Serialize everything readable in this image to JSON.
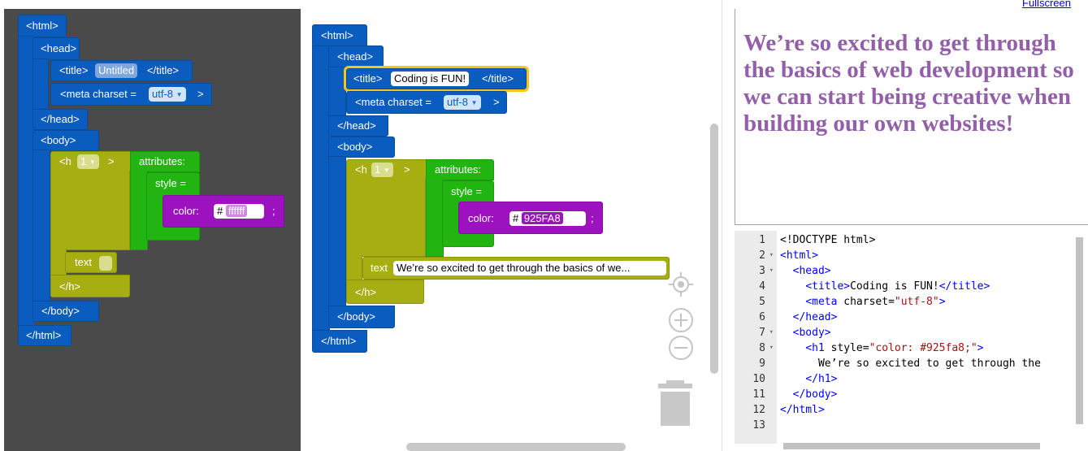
{
  "toolbox": {
    "html_open": "<html>",
    "head_open": "<head>",
    "title_open": "<title>",
    "title_value": "Untitled",
    "title_close": "</title>",
    "meta_label": "<meta charset =",
    "meta_value": "utf-8",
    "meta_close": ">",
    "head_close": "</head>",
    "body_open": "<body>",
    "h_label": "<h",
    "h_level": "1",
    "h_gt": ">",
    "attributes_label": "attributes:",
    "style_label": "style =",
    "color_label": "color:",
    "hash": "#",
    "color_value": "ffffff",
    "semicolon": ";",
    "text_label": "text",
    "text_value": "",
    "h_close": "</h>",
    "body_close": "</body>",
    "html_close": "</html>"
  },
  "workspace": {
    "html_open": "<html>",
    "head_open": "<head>",
    "title_open": "<title>",
    "title_value": "Coding is FUN!",
    "title_close": "</title>",
    "meta_label": "<meta charset =",
    "meta_value": "utf-8",
    "meta_close": ">",
    "head_close": "</head>",
    "body_open": "<body>",
    "h_label": "<h",
    "h_level": "1",
    "h_gt": ">",
    "attributes_label": "attributes:",
    "style_label": "style =",
    "color_label": "color:",
    "hash": "#",
    "color_value": "925FA8",
    "semicolon": ";",
    "text_label": "text",
    "text_value": "We’re so excited to get through the basics of we...",
    "h_close": "</h>",
    "body_close": "</body>",
    "html_close": "</html>"
  },
  "controls": {
    "center_icon": "crosshair-icon",
    "zoom_in_icon": "plus-circle-icon",
    "zoom_out_icon": "minus-circle-icon",
    "trash_icon": "trash-icon"
  },
  "preview": {
    "fullscreen_label": "Fullscreen",
    "heading": "We’re so excited to get through the basics of web development so we can start being creative when building our own websites!",
    "heading_color": "#925fa8"
  },
  "editor": {
    "lines": [
      {
        "num": "1",
        "fold": ""
      },
      {
        "num": "2",
        "fold": "▾"
      },
      {
        "num": "3",
        "fold": "▾"
      },
      {
        "num": "4",
        "fold": ""
      },
      {
        "num": "5",
        "fold": ""
      },
      {
        "num": "6",
        "fold": ""
      },
      {
        "num": "7",
        "fold": "▾"
      },
      {
        "num": "8",
        "fold": "▾"
      },
      {
        "num": "9",
        "fold": ""
      },
      {
        "num": "10",
        "fold": ""
      },
      {
        "num": "11",
        "fold": ""
      },
      {
        "num": "12",
        "fold": ""
      },
      {
        "num": "13",
        "fold": ""
      }
    ],
    "code": {
      "l1": "<!DOCTYPE html>",
      "l2": "<html>",
      "l3": "<head>",
      "l4a": "<title>",
      "l4b": "Coding is FUN!",
      "l4c": "</title>",
      "l5a": "<meta ",
      "l5b": "charset=",
      "l5c": "\"utf-8\"",
      "l5d": ">",
      "l6": "</head>",
      "l7": "<body>",
      "l8a": "<h1 ",
      "l8b": "style=",
      "l8c": "\"color: #925fa8;\"",
      "l8d": ">",
      "l9": "We’re so excited to get through the",
      "l10": "</h1>",
      "l11": "</body>",
      "l12": "</html>"
    }
  },
  "colors": {
    "toolbox_bg": "#4a4a4a",
    "block_blue": "#0b5cbf",
    "block_olive": "#a6ae12",
    "block_green": "#22b410",
    "block_purple": "#9b12be",
    "highlight": "#f5c518"
  }
}
